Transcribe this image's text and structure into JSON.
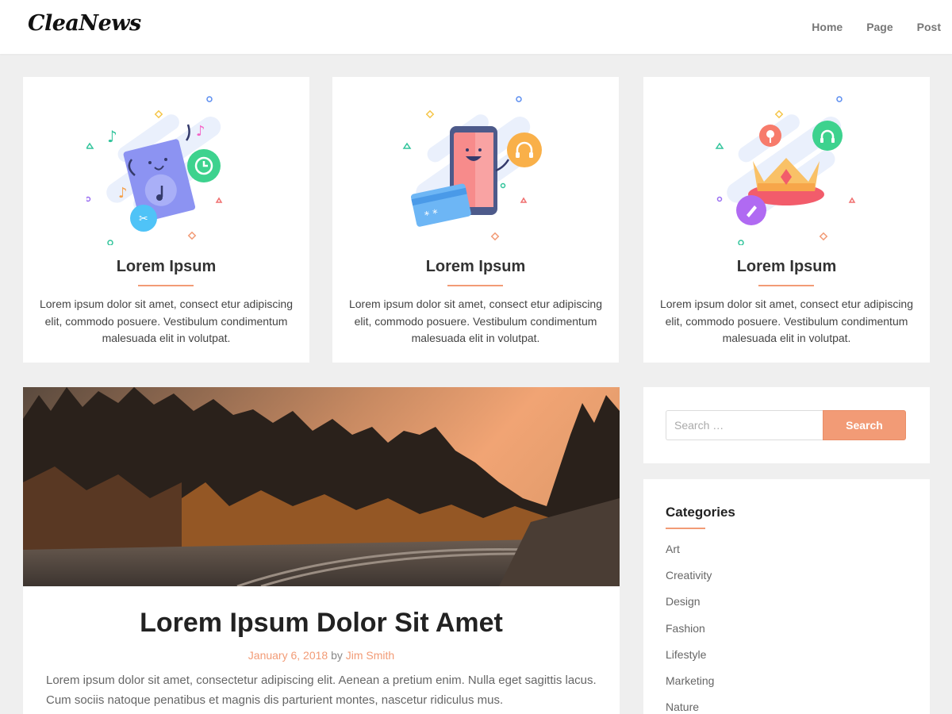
{
  "header": {
    "logo": "CleaNews",
    "nav": [
      "Home",
      "Page",
      "Post"
    ]
  },
  "features": [
    {
      "title": "Lorem Ipsum",
      "text": "Lorem ipsum dolor sit amet, consect etur adipiscing elit, commodo posuere. Vestibulum condimentum malesuada elit in volutpat.",
      "illustration": "music-document-illustration"
    },
    {
      "title": "Lorem Ipsum",
      "text": "Lorem ipsum dolor sit amet, consect etur adipiscing elit, commodo posuere. Vestibulum condimentum malesuada elit in volutpat.",
      "illustration": "smartphone-headphones-illustration"
    },
    {
      "title": "Lorem Ipsum",
      "text": "Lorem ipsum dolor sit amet, consect etur adipiscing elit, commodo posuere. Vestibulum condimentum malesuada elit in volutpat.",
      "illustration": "crown-illustration"
    }
  ],
  "post": {
    "image": "forest-railway-sunset-photo",
    "title": "Lorem Ipsum Dolor Sit Amet",
    "date": "January 6, 2018",
    "by": "by",
    "author": "Jim Smith",
    "excerpt": "Lorem ipsum dolor sit amet, consectetur adipiscing elit. Aenean a pretium enim. Nulla eget sagittis lacus. Cum sociis natoque penatibus et magnis dis parturient montes, nascetur ridiculus mus."
  },
  "search": {
    "placeholder": "Search …",
    "button": "Search"
  },
  "categories": {
    "title": "Categories",
    "items": [
      "Art",
      "Creativity",
      "Design",
      "Fashion",
      "Lifestyle",
      "Marketing",
      "Nature"
    ]
  },
  "colors": {
    "accent": "#f29b76",
    "background": "#efefef"
  }
}
